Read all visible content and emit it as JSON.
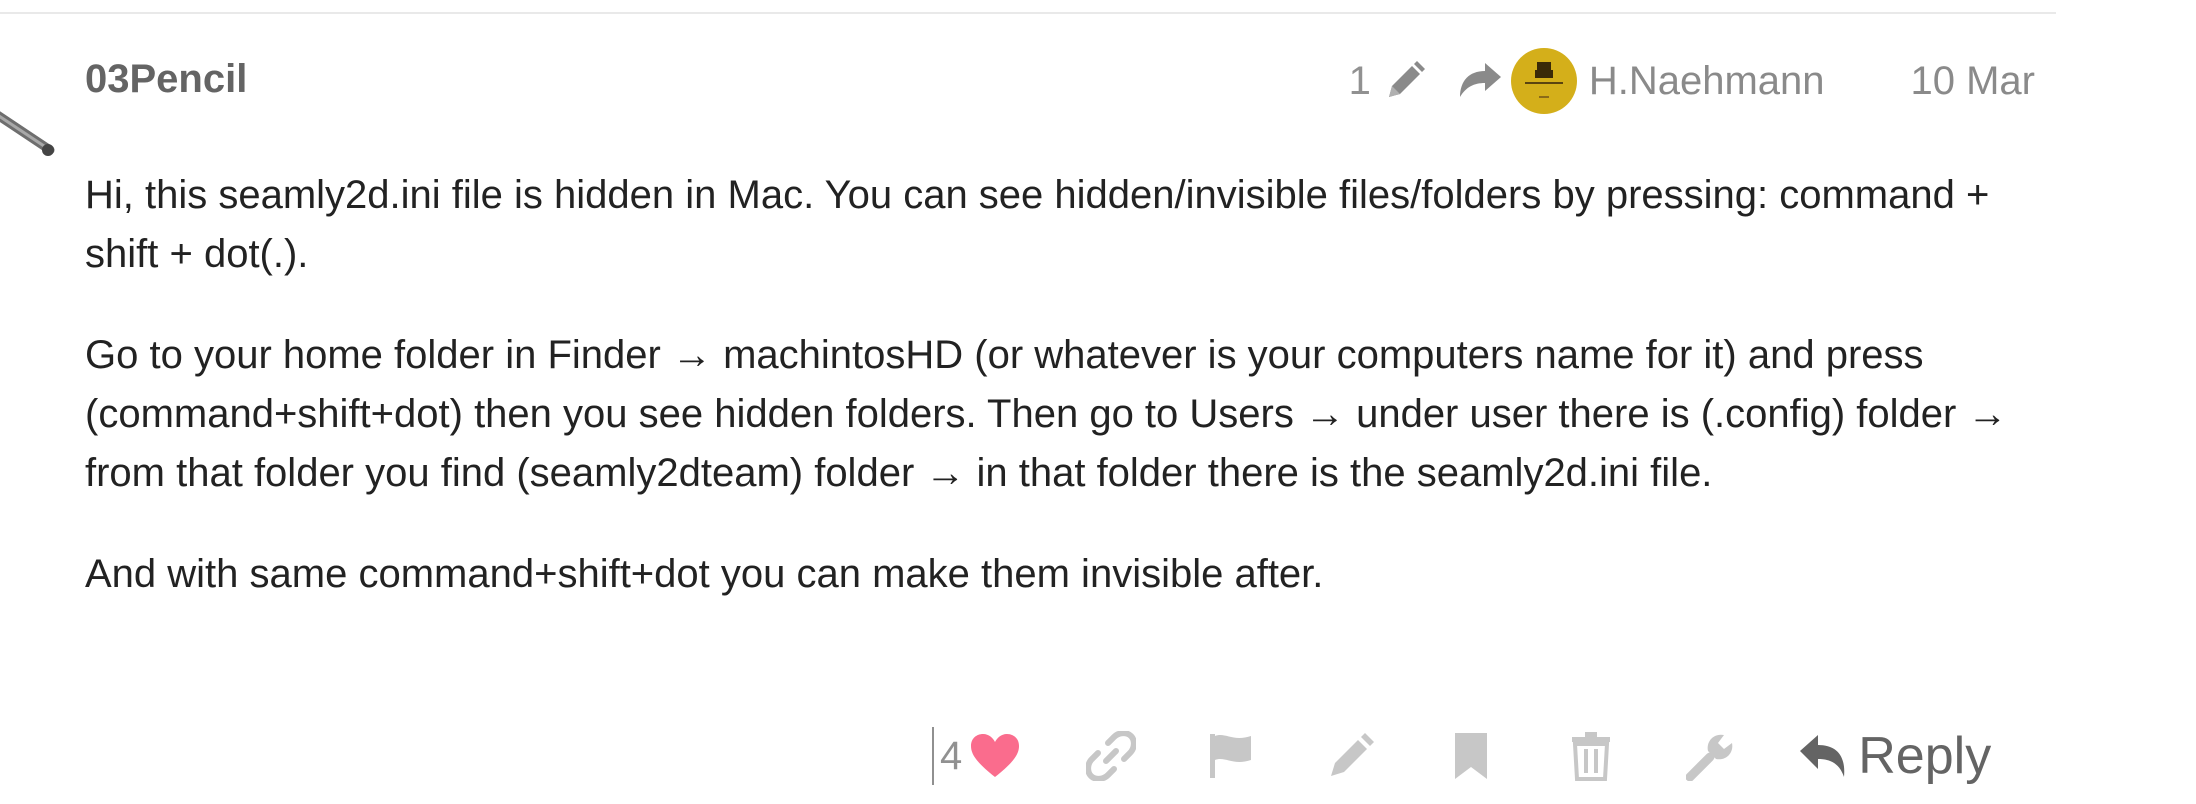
{
  "post": {
    "username": "03Pencil",
    "edit_count": "1",
    "reply_to_name": "H.Naehmann",
    "date": "10 Mar",
    "paragraphs": [
      "Hi, this seamly2d.ini file is hidden in Mac. You can see hidden/invisible files/folders by pressing: command + shift + dot(.).",
      "Go to your home folder in Finder → machintosHD (or whatever is your computers name for it) and press (command+shift+dot) then you see hidden folders. Then go to Users → under user there is (.config) folder → from that folder you find (seamly2dteam) folder → in that folder there is the seamly2d.ini file.",
      "And with same command+shift+dot you can make them invisible after."
    ]
  },
  "actions": {
    "like_count": "4",
    "reply_label": "Reply",
    "icons": [
      "heart-icon",
      "link-icon",
      "flag-icon",
      "pencil-icon",
      "bookmark-icon",
      "trash-icon",
      "wrench-icon",
      "reply-icon"
    ]
  },
  "colors": {
    "username": "#646464",
    "meta": "#8a8a8a",
    "action_icon": "#c7c7c7",
    "heart": "#fa6c8d",
    "avatar_bg": "#d4af1a"
  }
}
